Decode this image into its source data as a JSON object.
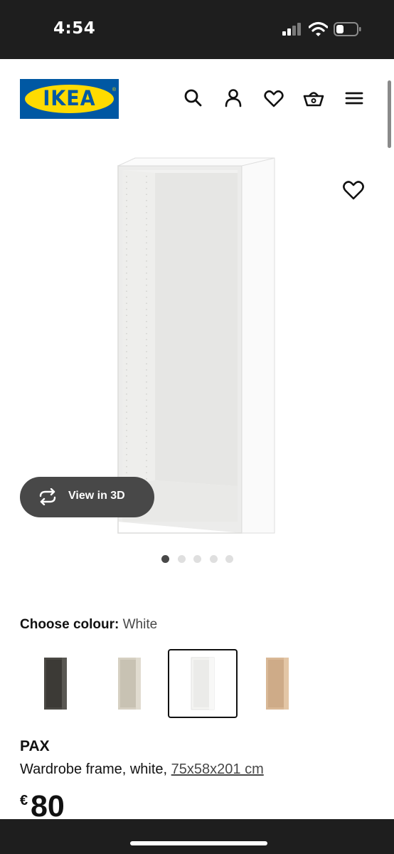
{
  "status_bar": {
    "time": "4:54",
    "icons": [
      "signal-icon",
      "wifi-icon",
      "battery-icon"
    ]
  },
  "header": {
    "logo_text": "IKEA",
    "icons": [
      "search-icon",
      "account-icon",
      "heart-icon",
      "basket-icon",
      "menu-icon"
    ]
  },
  "gallery": {
    "view3d_label": "View in 3D",
    "image_count": 5,
    "active_index": 0
  },
  "colour": {
    "label": "Choose colour:",
    "selected": "White",
    "swatches": [
      {
        "name": "black-brown",
        "color": "#4a4843",
        "selected": false
      },
      {
        "name": "grey-beige",
        "color": "#d6d0c2",
        "selected": false
      },
      {
        "name": "white",
        "color": "#f4f4f2",
        "selected": true
      },
      {
        "name": "white-stained-oak",
        "color": "#d9b896",
        "selected": false
      }
    ]
  },
  "product": {
    "name": "PAX",
    "description": "Wardrobe frame, white, ",
    "size": "75x58x201 cm",
    "currency": "€",
    "price": "80"
  },
  "colors": {
    "ikea_blue": "#0058a3",
    "ikea_yellow": "#ffdb00",
    "dark_pill": "#484848"
  }
}
